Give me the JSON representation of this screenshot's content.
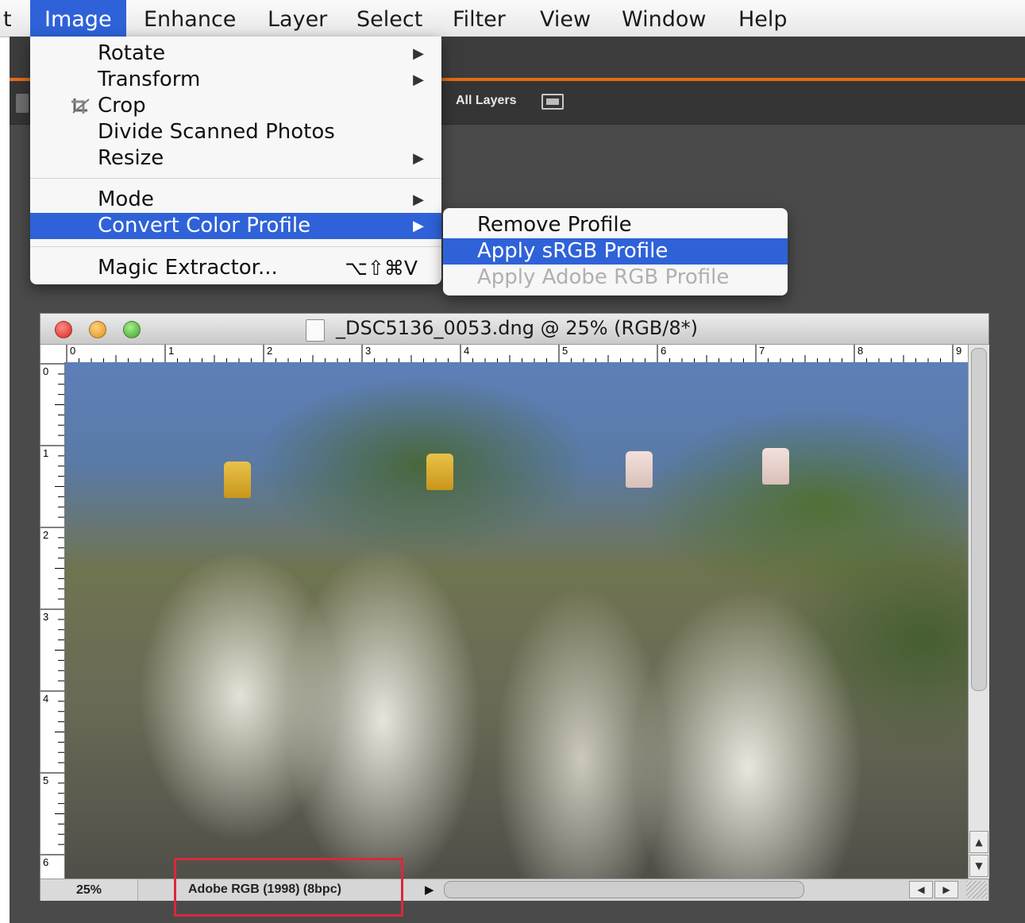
{
  "menubar": {
    "partial_left": "t",
    "items": [
      "Image",
      "Enhance",
      "Layer",
      "Select",
      "Filter",
      "View",
      "Window",
      "Help"
    ],
    "active": "Image"
  },
  "options_bar": {
    "all_layers": "All Layers",
    "icons": [
      "layers-stack-icon"
    ]
  },
  "image_menu": {
    "items": [
      {
        "label": "Rotate",
        "submenu": true
      },
      {
        "label": "Transform",
        "submenu": true
      },
      {
        "label": "Crop",
        "icon": "crop-icon"
      },
      {
        "label": "Divide Scanned Photos"
      },
      {
        "label": "Resize",
        "submenu": true
      },
      {
        "label": "Mode",
        "submenu": true
      },
      {
        "label": "Convert Color Profile",
        "submenu": true,
        "highlighted": true
      },
      {
        "label": "Magic Extractor...",
        "shortcut": "⌥⇧⌘V"
      }
    ],
    "arrow_glyph": "▶"
  },
  "convert_color_profile_submenu": {
    "items": [
      {
        "label": "Remove Profile",
        "state": "enabled"
      },
      {
        "label": "Apply sRGB Profile",
        "state": "highlighted"
      },
      {
        "label": "Apply Adobe RGB Profile",
        "state": "disabled"
      }
    ]
  },
  "document": {
    "title": "_DSC5136_0053.dng @ 25% (RGB/8*)",
    "traffic_lights": [
      "close",
      "minimize",
      "zoom"
    ],
    "ruler_top": [
      "0",
      "1",
      "2",
      "3",
      "4",
      "5",
      "6",
      "7",
      "8",
      "9"
    ],
    "ruler_left": [
      "0",
      "1",
      "2",
      "3",
      "4",
      "5",
      "6"
    ],
    "zoom": "25%",
    "profile_info": "Adobe RGB (1998) (8bpc)",
    "status_arrow": "▶",
    "scroll_up": "▲",
    "scroll_down": "▼",
    "scroll_left": "◀",
    "scroll_right": "▶"
  },
  "colors": {
    "highlight": "#2f62d8",
    "accent_orange": "#e56b17",
    "annotation_red": "#d9283c"
  }
}
